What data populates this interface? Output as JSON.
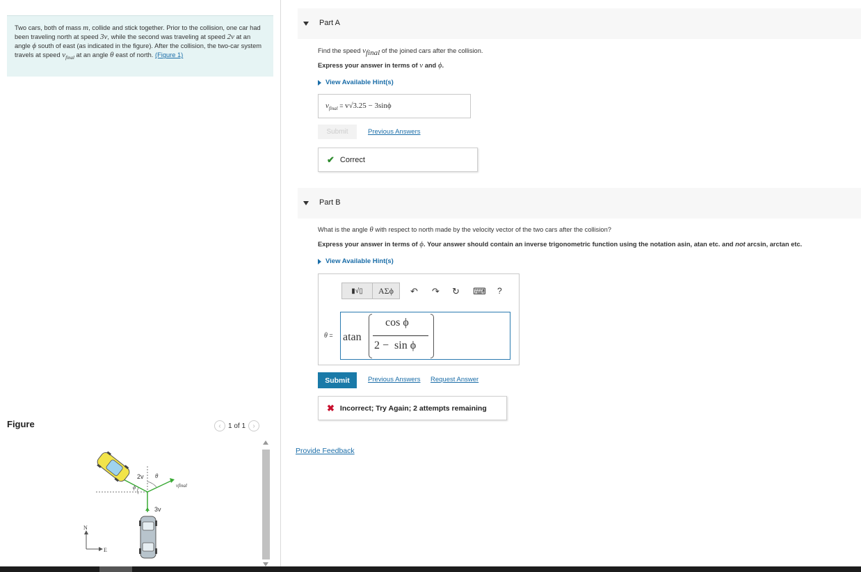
{
  "problem": {
    "line1": "Two cars, both of mass ",
    "m": "m",
    "line1b": ", collide and stick together. Prior to the collision, one car had been traveling north at speed ",
    "speed1": "3v",
    "line1c": ", while the second was traveling at speed ",
    "speed2": "2v",
    "line1d": " at an angle ",
    "phi": "ϕ",
    "line1e": " south of east (as indicated in the figure). After the collision, the two-car system travels at speed ",
    "vfinal_v": "v",
    "vfinal_sub": "final",
    "line1f": " at an angle ",
    "theta": "θ",
    "line1g": " east of north. ",
    "figure_link": "(Figure 1)"
  },
  "figure": {
    "title": "Figure",
    "pager_text": "1 of 1",
    "prev_icon": "‹",
    "next_icon": "›",
    "labels": {
      "v2": "2v",
      "theta": "θ",
      "phi": "ϕ",
      "vfinal": "vfinal",
      "v3": "3v",
      "north": "N",
      "east": "E"
    }
  },
  "partA": {
    "label": "Part A",
    "question_pre": "Find the speed ",
    "question_v": "v",
    "question_sub": "final",
    "question_post": " of the joined cars after the collision.",
    "express_pre": "Express your answer in terms of ",
    "express_v": "v",
    "express_mid": " and ",
    "express_phi": "ϕ",
    "express_post": ".",
    "hint": "View Available Hint(s)",
    "answer_v": "v",
    "answer_sub": "final",
    "answer_eq": " = ",
    "answer_value": "v√3.25 − 3sinϕ",
    "submit": "Submit",
    "previous_answers": "Previous Answers",
    "feedback": "Correct"
  },
  "partB": {
    "label": "Part B",
    "question_pre": "What is the angle ",
    "question_theta": "θ",
    "question_post": " with respect to north made by the velocity vector of the two cars after the collision?",
    "express_pre": "Express your answer in terms of ",
    "express_phi": "ϕ",
    "express_post": ". Your answer should contain an inverse trigonometric function using the notation asin, atan etc. and ",
    "express_not": "not",
    "express_end": " arcsin, arctan etc.",
    "hint": "View Available Hint(s)",
    "toolbar": {
      "templates": "▮√▯",
      "symbols": "ΑΣϕ",
      "undo": "↶",
      "redo": "↷",
      "reset": "↻",
      "keyboard": "⌨",
      "help": "?"
    },
    "theta_lbl": "θ",
    "eq": " =",
    "atan": "atan",
    "numerator": "cos ϕ",
    "denominator": "2 −  sin ϕ",
    "submit": "Submit",
    "previous_answers": "Previous Answers",
    "request_answer": "Request Answer",
    "feedback": "Incorrect; Try Again; 2 attempts remaining"
  },
  "provide_feedback": "Provide Feedback",
  "colors": {
    "accent": "#1a7aa8",
    "link": "#1a6da8",
    "correct": "#2e8b2e",
    "incorrect": "#c8102e",
    "problem_bg": "#e6f4f4",
    "vector_green": "#3aaa35"
  }
}
